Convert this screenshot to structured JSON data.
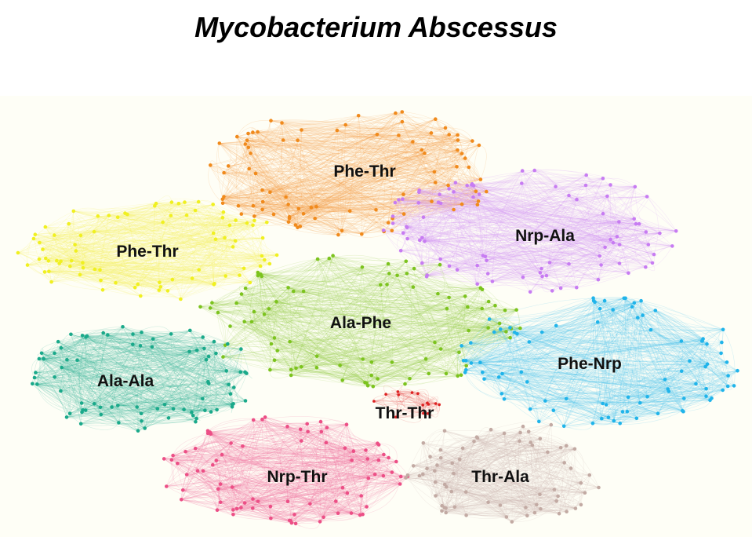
{
  "title": "Mycobacterium Abscessus",
  "clusters": [
    {
      "id": "orange",
      "label": "Phe-Thr",
      "color": "#f08a1c",
      "edge_color": "#f5a04a"
    },
    {
      "id": "yellow",
      "label": "Phe-Thr",
      "color": "#f0f020",
      "edge_color": "#f6f060"
    },
    {
      "id": "purple",
      "label": "Nrp-Ala",
      "color": "#c77cf2",
      "edge_color": "#d49cf5"
    },
    {
      "id": "green",
      "label": "Ala-Phe",
      "color": "#7cc31e",
      "edge_color": "#96cf4a"
    },
    {
      "id": "teal",
      "label": "Ala-Ala",
      "color": "#1aa98a",
      "edge_color": "#3ab89c"
    },
    {
      "id": "blue",
      "label": "Phe-Nrp",
      "color": "#20b4ea",
      "edge_color": "#4cc4ef"
    },
    {
      "id": "red",
      "label": "Thr-Thr",
      "color": "#dd2222",
      "edge_color": "#e65050"
    },
    {
      "id": "pink",
      "label": "Nrp-Thr",
      "color": "#ec4f86",
      "edge_color": "#f0739e"
    },
    {
      "id": "taupe",
      "label": "Thr-Ala",
      "color": "#c2aaa3",
      "edge_color": "#cdb8b2"
    }
  ],
  "background_color": "#fefef6"
}
